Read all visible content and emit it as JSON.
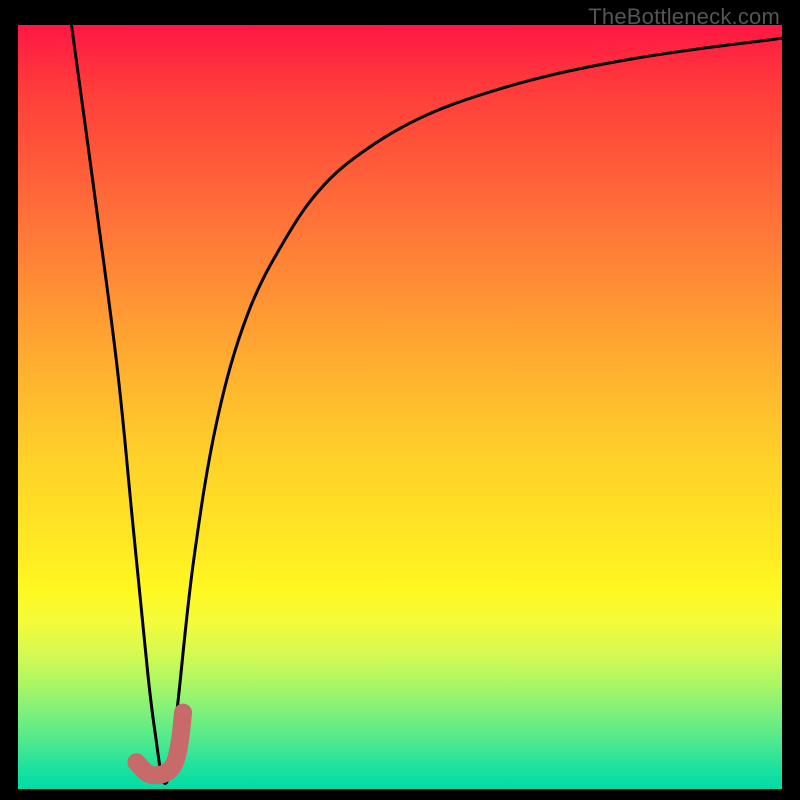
{
  "watermark": "TheBottleneck.com",
  "chart_data": {
    "type": "line",
    "title": "",
    "xlabel": "",
    "ylabel": "",
    "xlim": [
      0,
      100
    ],
    "ylim": [
      0,
      100
    ],
    "background_gradient": {
      "top_color": "#ff1744",
      "bottom_color": "#00dca6",
      "description": "vertical red-to-green gradient, yellow at mid"
    },
    "series": [
      {
        "name": "bottleneck-curve",
        "stroke": "#000000",
        "stroke_width": 2,
        "x": [
          7,
          10,
          13,
          15,
          17,
          18,
          19,
          20,
          21,
          23,
          26,
          30,
          35,
          40,
          46,
          53,
          61,
          70,
          80,
          90,
          98,
          100
        ],
        "values": [
          100,
          78,
          55,
          35,
          15,
          7,
          1,
          3,
          12,
          30,
          48,
          62,
          72,
          79,
          84,
          88,
          91,
          93.5,
          95.5,
          97,
          98,
          98.3
        ]
      }
    ],
    "marker": {
      "name": "j-marker",
      "color": "#c96a6a",
      "stroke_width": 18,
      "dot": {
        "x": 15.5,
        "y": 3.5,
        "r": 7
      },
      "path_points": [
        {
          "x": 15.5,
          "y": 3.5
        },
        {
          "x": 17.0,
          "y": 1.8
        },
        {
          "x": 19.0,
          "y": 1.8
        },
        {
          "x": 20.5,
          "y": 3.0
        },
        {
          "x": 21.2,
          "y": 6.0
        },
        {
          "x": 21.6,
          "y": 10.0
        }
      ]
    }
  }
}
